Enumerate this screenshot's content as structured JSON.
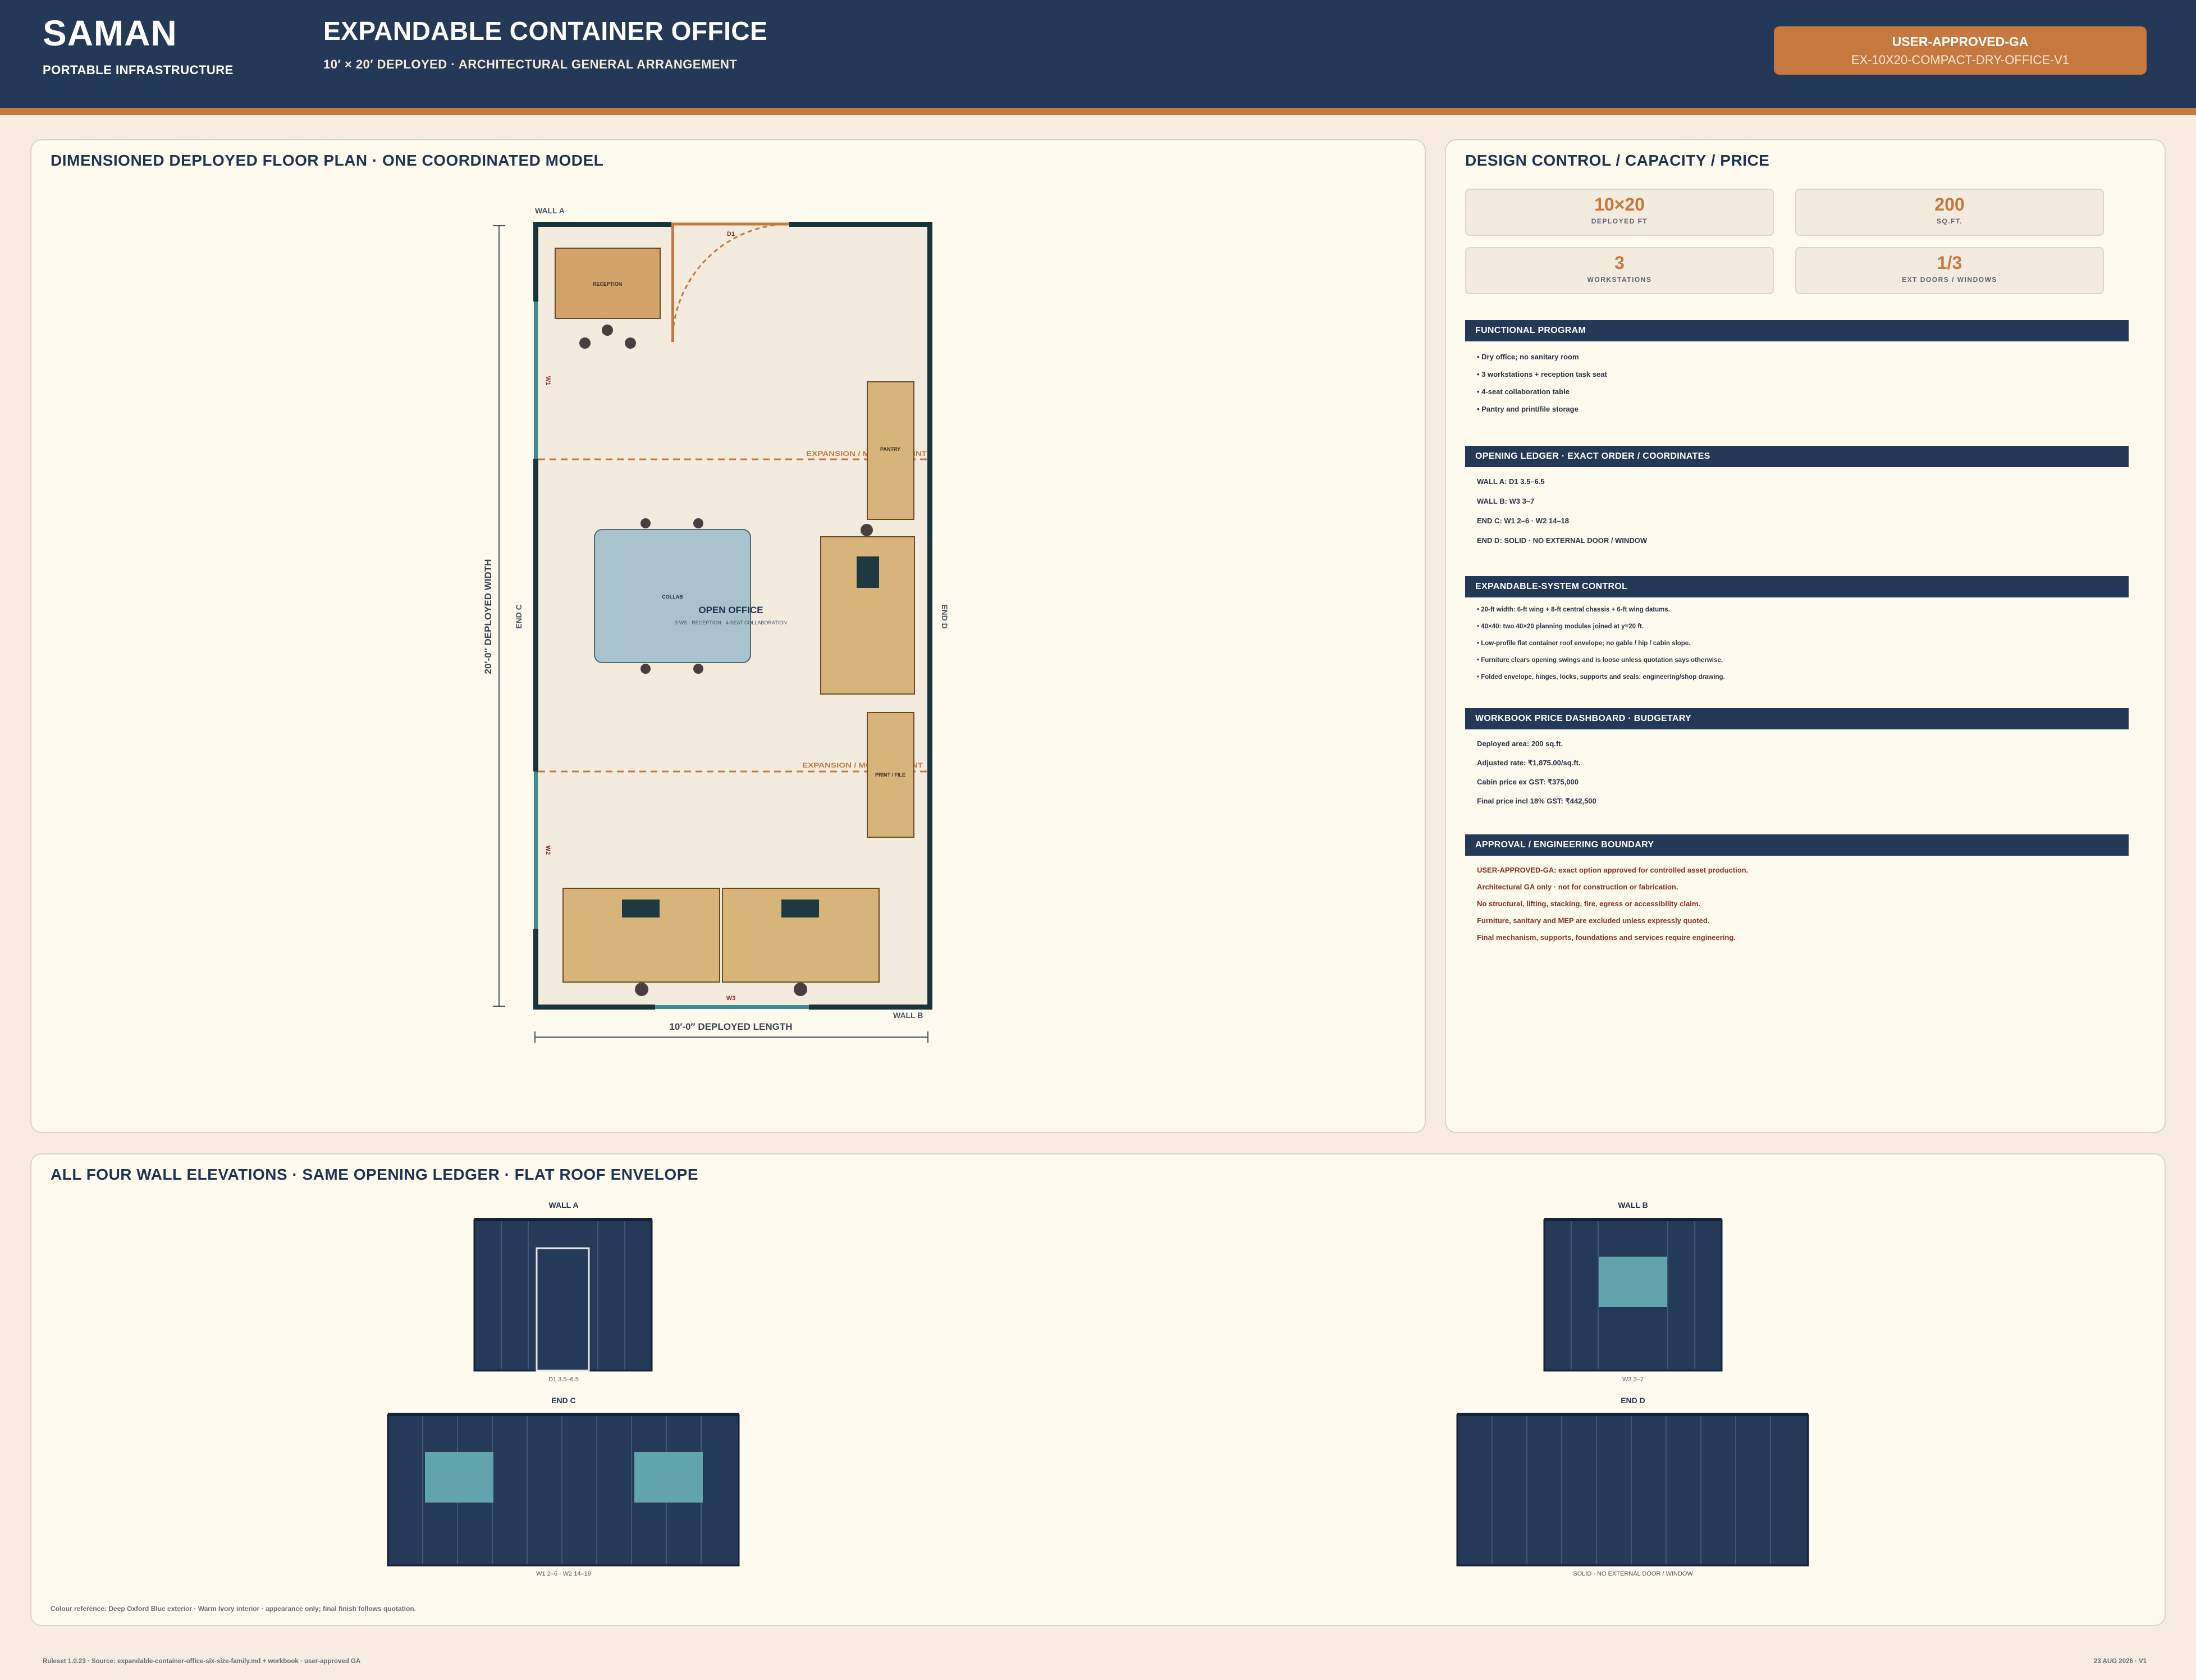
{
  "header": {
    "brand": "SAMAN",
    "brand_sub": "PORTABLE INFRASTRUCTURE",
    "title": "EXPANDABLE CONTAINER OFFICE",
    "subtitle": "10′ × 20′ DEPLOYED · ARCHITECTURAL GENERAL ARRANGEMENT",
    "badge_line1": "USER-APPROVED-GA",
    "badge_line2": "EX-10X20-COMPACT-DRY-OFFICE-V1"
  },
  "plan": {
    "title": "DIMENSIONED DEPLOYED FLOOR PLAN · ONE COORDINATED MODEL",
    "wall_a": "WALL A",
    "wall_b": "WALL B",
    "end_c": "END C",
    "end_d": "END D",
    "d1": "D1",
    "w1": "W1",
    "w2": "W2",
    "w3": "W3",
    "reception": "RECEPTION",
    "pantry": "PANTRY",
    "collab": "COLLAB",
    "print_file": "PRINT / FILE",
    "open_office": "OPEN OFFICE",
    "open_office_sub": "3 WS · RECEPTION · 4-SEAT COLLABORATION",
    "expansion_1": "EXPANSION / MODULE JOINT",
    "expansion_2": "EXPANSION / MODULE JOINT",
    "dim_width": "20′-0″ DEPLOYED WIDTH",
    "dim_length": "10′-0″ DEPLOYED LENGTH"
  },
  "control": {
    "title": "DESIGN CONTROL / CAPACITY / PRICE",
    "metrics": [
      {
        "value": "10×20",
        "label": "DEPLOYED FT"
      },
      {
        "value": "200",
        "label": "SQ.FT."
      },
      {
        "value": "3",
        "label": "WORKSTATIONS"
      },
      {
        "value": "1/3",
        "label": "EXT DOORS / WINDOWS"
      }
    ],
    "functional_title": "FUNCTIONAL PROGRAM",
    "functional": [
      "• Dry office; no sanitary room",
      "• 3 workstations + reception task seat",
      "• 4-seat collaboration table",
      "• Pantry and print/file storage"
    ],
    "ledger_title": "OPENING LEDGER · EXACT ORDER / COORDINATES",
    "ledger": [
      "WALL A: D1 3.5–6.5",
      "WALL B: W3 3–7",
      "END C: W1 2–6 · W2 14–18",
      "END D: SOLID · NO EXTERNAL DOOR / WINDOW"
    ],
    "system_title": "EXPANDABLE-SYSTEM CONTROL",
    "system": [
      "• 20-ft width: 6-ft wing + 8-ft central chassis + 6-ft wing datums.",
      "• 40×40: two 40×20 planning modules joined at y=20 ft.",
      "• Low-profile flat container roof envelope; no gable / hip / cabin slope.",
      "• Furniture clears opening swings and is loose unless quotation says otherwise.",
      "• Folded envelope, hinges, locks, supports and seals: engineering/shop drawing."
    ],
    "price_title": "WORKBOOK PRICE DASHBOARD · BUDGETARY",
    "price": [
      "Deployed area: 200 sq.ft.",
      "Adjusted rate: ₹1,875.00/sq.ft.",
      "Cabin price ex GST: ₹375,000",
      "Final price incl 18% GST: ₹442,500"
    ],
    "approval_title": "APPROVAL / ENGINEERING BOUNDARY",
    "approval": [
      "USER-APPROVED-GA: exact option approved for controlled asset production.",
      "Architectural GA only · not for construction or fabrication.",
      "No structural, lifting, stacking, fire, egress or accessibility claim.",
      "Furniture, sanitary and MEP are excluded unless expressly quoted.",
      "Final mechanism, supports, foundations and services require engineering."
    ]
  },
  "elevations": {
    "title": "ALL FOUR WALL ELEVATIONS · SAME OPENING LEDGER · FLAT ROOF ENVELOPE",
    "wall_a_title": "WALL A",
    "wall_a_caption": "D1 3.5–6.5",
    "wall_b_title": "WALL B",
    "wall_b_caption": "W3 3–7",
    "end_c_title": "END C",
    "end_c_caption": "W1 2–6 · W2 14–18",
    "end_d_title": "END D",
    "end_d_caption": "SOLID · NO EXTERNAL DOOR / WINDOW",
    "note": "Colour reference: Deep Oxford Blue exterior · Warm Ivory interior · appearance only; final finish follows quotation."
  },
  "footer": {
    "left": "Ruleset 1.0.23 · Source: expandable-container-office-six-size-family.md + workbook · user-approved GA",
    "right": "23 AUG 2026 · V1"
  },
  "colors": {
    "navy": "#243958",
    "copper": "#c5793f",
    "teal": "#3c8d93",
    "wood": "#d6b47a",
    "collab": "#a8c3cd"
  }
}
